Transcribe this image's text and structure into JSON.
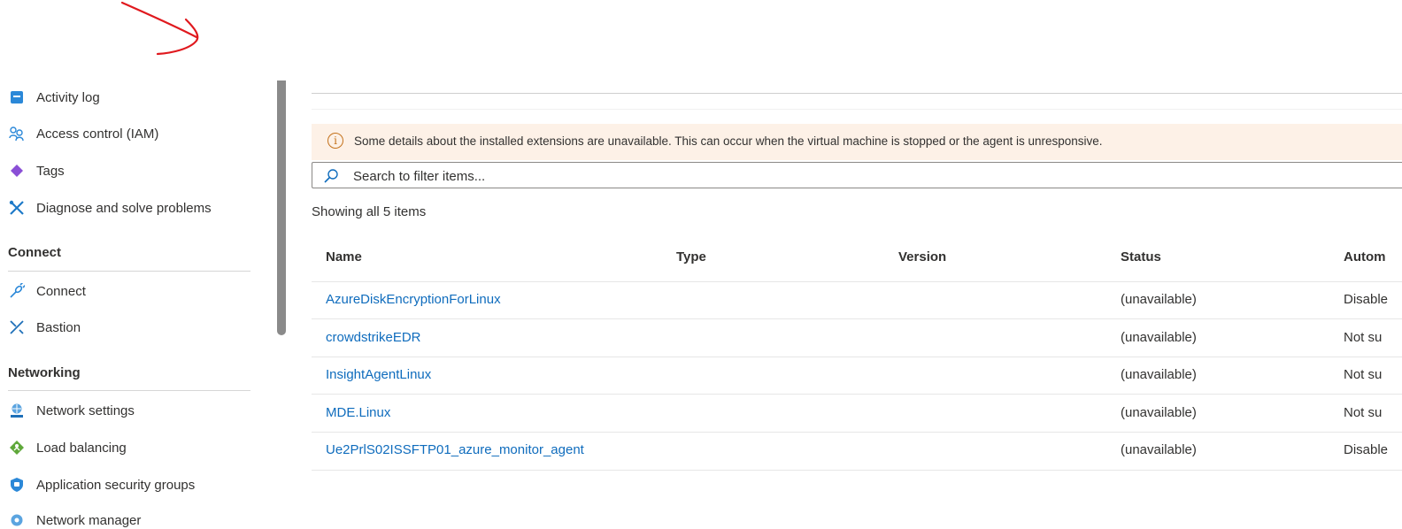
{
  "sidebar": {
    "items_top": [
      {
        "label": "Activity log",
        "icon": "activity-log-icon"
      },
      {
        "label": "Access control (IAM)",
        "icon": "access-control-icon"
      },
      {
        "label": "Tags",
        "icon": "tag-icon"
      },
      {
        "label": "Diagnose and solve problems",
        "icon": "diagnose-icon"
      }
    ],
    "sections": [
      {
        "title": "Connect",
        "items": [
          {
            "label": "Connect",
            "icon": "connect-plug-icon"
          },
          {
            "label": "Bastion",
            "icon": "bastion-icon"
          }
        ]
      },
      {
        "title": "Networking",
        "items": [
          {
            "label": "Network settings",
            "icon": "network-settings-icon"
          },
          {
            "label": "Load balancing",
            "icon": "load-balancing-icon"
          },
          {
            "label": "Application security groups",
            "icon": "shield-icon"
          },
          {
            "label": "Network manager",
            "icon": "network-manager-icon"
          }
        ]
      }
    ]
  },
  "banner": {
    "icon": "info-icon",
    "text": "Some details about the installed extensions are unavailable. This can occur when the virtual machine is stopped or the agent is unresponsive."
  },
  "search": {
    "placeholder": "Search to filter items...",
    "value": ""
  },
  "table": {
    "count_text": "Showing all 5 items",
    "columns": [
      "Name",
      "Type",
      "Version",
      "Status",
      "Autom"
    ],
    "rows": [
      {
        "name": "AzureDiskEncryptionForLinux",
        "type": "",
        "version": "",
        "status": "(unavailable)",
        "auto": "Disable"
      },
      {
        "name": "crowdstrikeEDR",
        "type": "",
        "version": "",
        "status": "(unavailable)",
        "auto": "Not su"
      },
      {
        "name": "InsightAgentLinux",
        "type": "",
        "version": "",
        "status": "(unavailable)",
        "auto": "Not su"
      },
      {
        "name": "MDE.Linux",
        "type": "",
        "version": "",
        "status": "(unavailable)",
        "auto": "Not su"
      },
      {
        "name": "Ue2PrlS02ISSFTP01_azure_monitor_agent",
        "type": "",
        "version": "",
        "status": "(unavailable)",
        "auto": "Disable"
      }
    ]
  },
  "colors": {
    "link": "#0f6cbd",
    "banner_bg": "#fdf1e7",
    "annotation": "#e0191e"
  }
}
